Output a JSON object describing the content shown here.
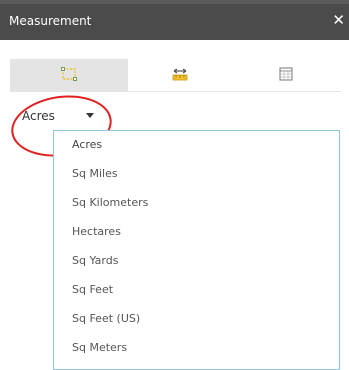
{
  "window": {
    "title": "Measurement",
    "close_label": "✕"
  },
  "tabs": [
    {
      "icon": "area-icon",
      "active": true
    },
    {
      "icon": "distance-icon",
      "active": false
    },
    {
      "icon": "location-icon",
      "active": false
    }
  ],
  "unit_select": {
    "value": "Acres"
  },
  "unit_options": [
    "Acres",
    "Sq Miles",
    "Sq Kilometers",
    "Hectares",
    "Sq Yards",
    "Sq Feet",
    "Sq Feet (US)",
    "Sq Meters"
  ],
  "colors": {
    "titlebar": "#4b4b4b",
    "tab_icon": "#f0c030",
    "annotation_circle": "#e02020",
    "dropdown_border": "#93c6dc"
  }
}
